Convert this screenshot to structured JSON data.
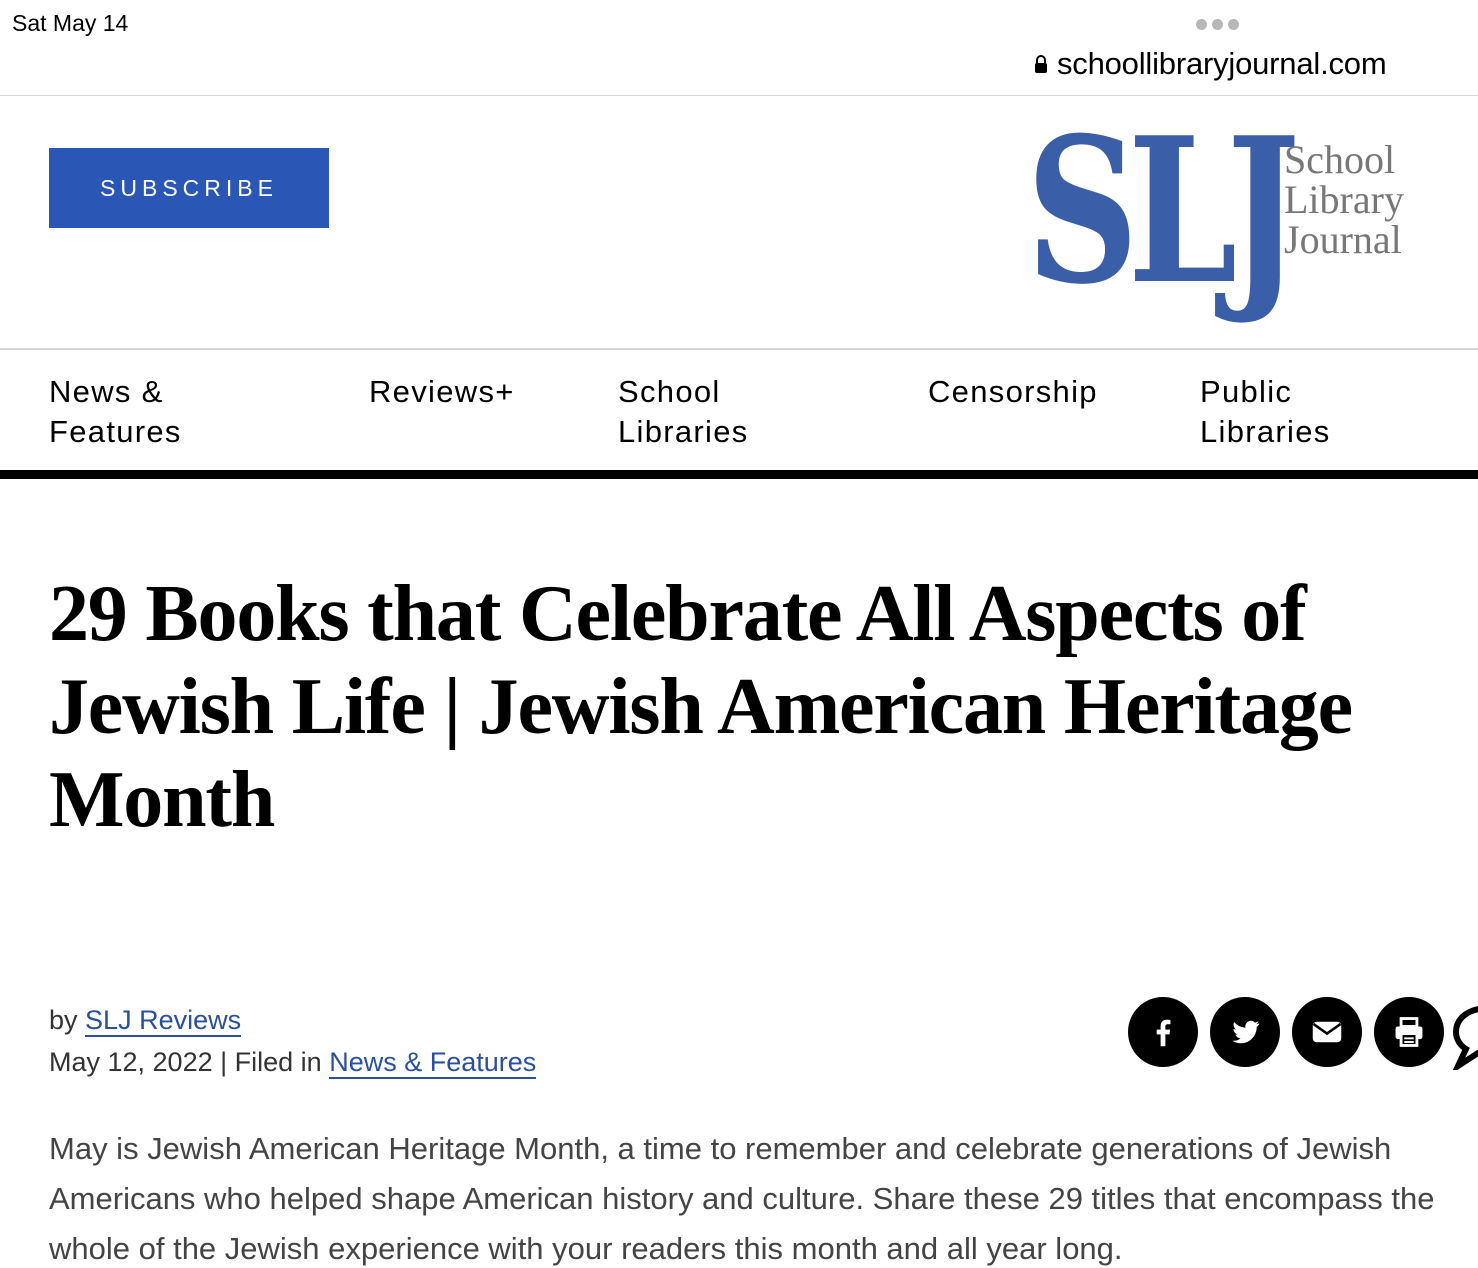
{
  "status_bar": {
    "time": "Sat May 14"
  },
  "browser": {
    "url": "schoollibraryjournal.com"
  },
  "header": {
    "subscribe_label": "SUBSCRIBE",
    "logo": {
      "mark": "SLJ",
      "line1": "School",
      "line2": "Library",
      "line3": "Journal",
      "mark_color": "#3a5ea8"
    }
  },
  "nav": {
    "items": [
      {
        "line1": "News &",
        "line2": "Features"
      },
      {
        "line1": "Reviews+",
        "line2": ""
      },
      {
        "line1": "School",
        "line2": "Libraries"
      },
      {
        "line1": "Censorship",
        "line2": ""
      },
      {
        "line1": "Public",
        "line2": "Libraries"
      }
    ]
  },
  "article": {
    "headline": "29 Books that Celebrate All Aspects of Jewish Life | Jewish American Heritage Month",
    "by_prefix": "by",
    "author": "SLJ Reviews",
    "date": "May 12, 2022",
    "filed_prefix": "| Filed in",
    "category": "News & Features",
    "intro": "May is Jewish American Heritage Month, a time to remember and celebrate generations of Jewish Americans who helped shape American history and culture. Share these 29 titles that encompass the whole of the Jewish experience with your readers this month and all year long."
  },
  "share": {
    "icons": [
      "facebook-icon",
      "twitter-icon",
      "email-icon",
      "print-icon",
      "comment-icon"
    ]
  },
  "colors": {
    "accent": "#2a57b6",
    "link": "#2a4f9c",
    "text": "#111111"
  }
}
